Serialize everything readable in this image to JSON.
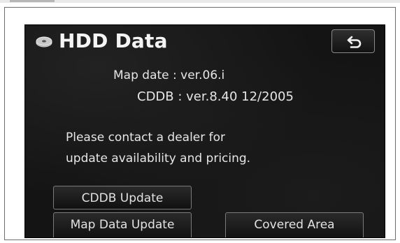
{
  "screen": {
    "title": "HDD Data",
    "title_icon": "disk-drive-icon",
    "back_icon": "return-arrow-icon"
  },
  "info": {
    "map_date": "Map date : ver.06.i",
    "cddb": "CDDB : ver.8.40 12/2005"
  },
  "message": {
    "line1": "Please contact a dealer for",
    "line2": "update availability and pricing."
  },
  "buttons": {
    "cddb_update": "CDDB Update",
    "map_data_update": "Map Data Update",
    "covered_area": "Covered Area"
  },
  "colors": {
    "screen_background": "#141414",
    "text": "#e6e6e6",
    "button_border": "#7a7a7a"
  }
}
